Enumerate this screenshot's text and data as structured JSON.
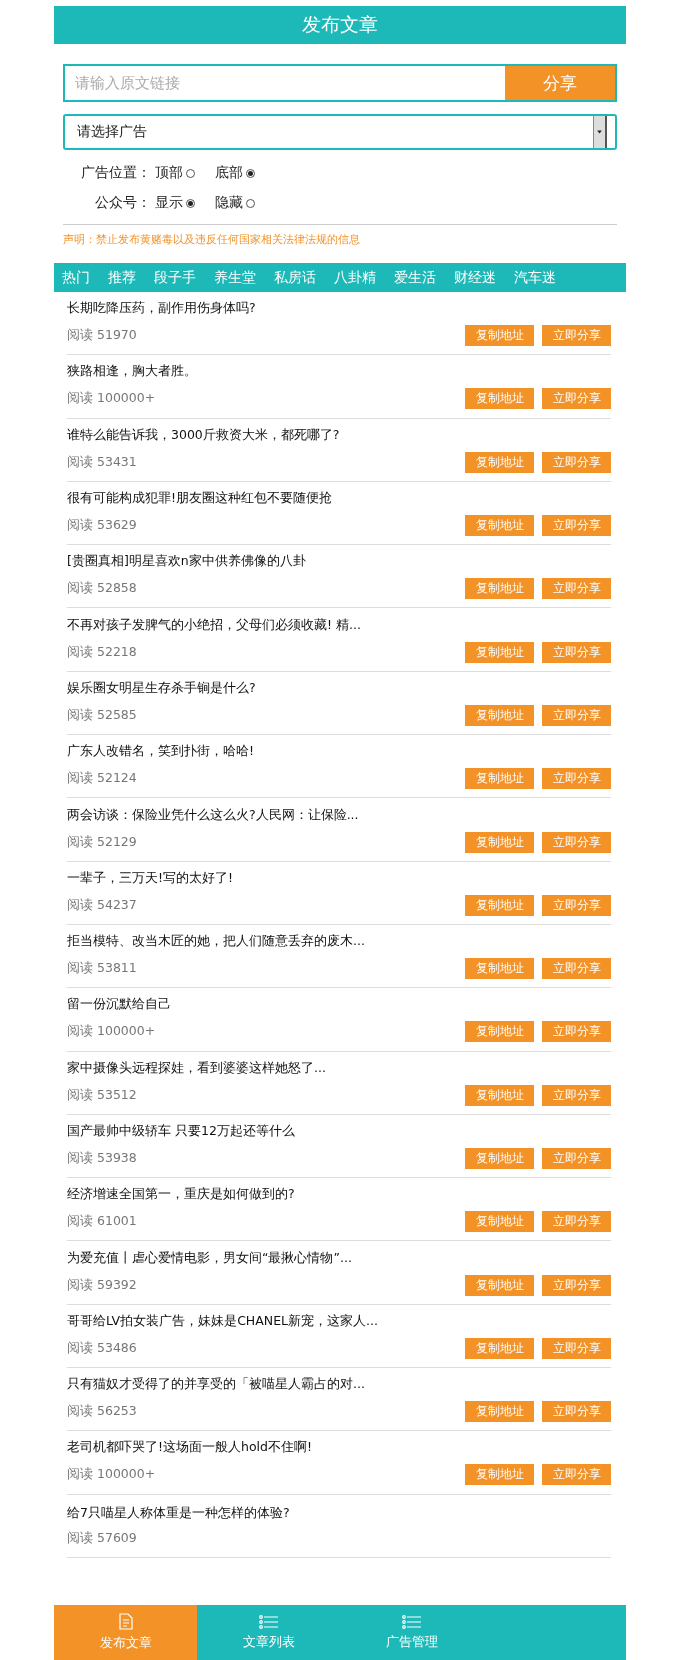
{
  "header": {
    "title": "发布文章"
  },
  "link_form": {
    "placeholder": "请输入原文链接",
    "button": "分享"
  },
  "ad_select": {
    "value": "请选择广告"
  },
  "options": [
    {
      "label": "广告位置：",
      "choices": [
        {
          "label": "顶部",
          "selected": false
        },
        {
          "label": "底部",
          "selected": true
        }
      ]
    },
    {
      "label": "公众号：",
      "choices": [
        {
          "label": "显示",
          "selected": true
        },
        {
          "label": "隐藏",
          "selected": false
        }
      ]
    }
  ],
  "notice": "声明：禁止发布黄赌毒以及违反任何国家相关法律法规的信息",
  "categories": [
    {
      "label": "热门"
    },
    {
      "label": "推荐"
    },
    {
      "label": "段子手"
    },
    {
      "label": "养生堂"
    },
    {
      "label": "私房话"
    },
    {
      "label": "八卦精"
    },
    {
      "label": "爱生活"
    },
    {
      "label": "财经迷"
    },
    {
      "label": "汽车迷"
    }
  ],
  "articles": [
    {
      "title": "长期吃降压药，副作用伤身体吗?",
      "reads": "阅读 51970",
      "copy_button": "复制地址",
      "share_button": "立即分享"
    },
    {
      "title": "狭路相逢，胸大者胜。",
      "reads": "阅读 100000+",
      "copy_button": "复制地址",
      "share_button": "立即分享"
    },
    {
      "title": "谁特么能告诉我，3000斤救资大米，都死哪了?",
      "reads": "阅读 53431",
      "copy_button": "复制地址",
      "share_button": "立即分享"
    },
    {
      "title": "很有可能构成犯罪!朋友圈这种红包不要随便抢",
      "reads": "阅读 53629",
      "copy_button": "复制地址",
      "share_button": "立即分享"
    },
    {
      "title": "[贵圈真相]明星喜欢n家中供养佛像的八卦",
      "reads": "阅读 52858",
      "copy_button": "复制地址",
      "share_button": "立即分享"
    },
    {
      "title": "不再对孩子发脾气的小绝招，父母们必须收藏! 精...",
      "reads": "阅读 52218",
      "copy_button": "复制地址",
      "share_button": "立即分享"
    },
    {
      "title": "娱乐圈女明星生存杀手锏是什么?",
      "reads": "阅读 52585",
      "copy_button": "复制地址",
      "share_button": "立即分享"
    },
    {
      "title": "广东人改错名，笑到扑街，哈哈!",
      "reads": "阅读 52124",
      "copy_button": "复制地址",
      "share_button": "立即分享"
    },
    {
      "title": "两会访谈：保险业凭什么这么火?人民网：让保险...",
      "reads": "阅读 52129",
      "copy_button": "复制地址",
      "share_button": "立即分享"
    },
    {
      "title": "一辈子，三万天!写的太好了!",
      "reads": "阅读 54237",
      "copy_button": "复制地址",
      "share_button": "立即分享"
    },
    {
      "title": "拒当模特、改当木匠的她，把人们随意丢弃的废木...",
      "reads": "阅读 53811",
      "copy_button": "复制地址",
      "share_button": "立即分享"
    },
    {
      "title": "留一份沉默给自己",
      "reads": "阅读 100000+",
      "copy_button": "复制地址",
      "share_button": "立即分享"
    },
    {
      "title": "家中摄像头远程探娃，看到婆婆这样她怒了...",
      "reads": "阅读 53512",
      "copy_button": "复制地址",
      "share_button": "立即分享"
    },
    {
      "title": "国产最帅中级轿车 只要12万起还等什么",
      "reads": "阅读 53938",
      "copy_button": "复制地址",
      "share_button": "立即分享"
    },
    {
      "title": "经济增速全国第一，重庆是如何做到的?",
      "reads": "阅读 61001",
      "copy_button": "复制地址",
      "share_button": "立即分享"
    },
    {
      "title": "为爱充值丨虐心爱情电影，男女间“最揪心情物”...",
      "reads": "阅读 59392",
      "copy_button": "复制地址",
      "share_button": "立即分享"
    },
    {
      "title": "哥哥给LV拍女装广告，妹妹是CHANEL新宠，这家人...",
      "reads": "阅读 53486",
      "copy_button": "复制地址",
      "share_button": "立即分享"
    },
    {
      "title": "只有猫奴才受得了的并享受的「被喵星人霸占的对...",
      "reads": "阅读 56253",
      "copy_button": "复制地址",
      "share_button": "立即分享"
    },
    {
      "title": "老司机都吓哭了!这场面一般人hold不住啊!",
      "reads": "阅读 100000+",
      "copy_button": "复制地址",
      "share_button": "立即分享"
    },
    {
      "title": "给7只喵星人称体重是一种怎样的体验?",
      "reads": "阅读 57609"
    }
  ],
  "bottom_nav": [
    {
      "label": "发布文章",
      "kind": "document",
      "selected": true
    },
    {
      "label": "文章列表",
      "kind": "list",
      "selected": false
    },
    {
      "label": "广告管理",
      "kind": "list",
      "selected": false
    }
  ]
}
